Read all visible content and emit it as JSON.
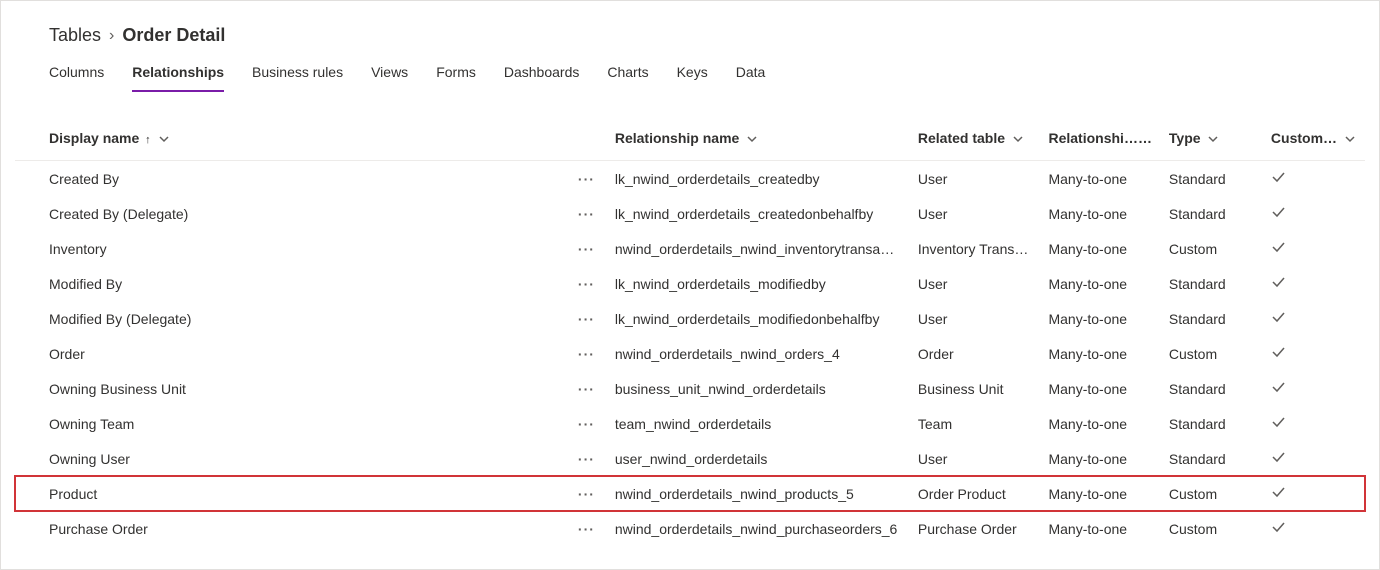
{
  "breadcrumb": {
    "root": "Tables",
    "current": "Order Detail"
  },
  "tabs": [
    {
      "label": "Columns",
      "active": false
    },
    {
      "label": "Relationships",
      "active": true
    },
    {
      "label": "Business rules",
      "active": false
    },
    {
      "label": "Views",
      "active": false
    },
    {
      "label": "Forms",
      "active": false
    },
    {
      "label": "Dashboards",
      "active": false
    },
    {
      "label": "Charts",
      "active": false
    },
    {
      "label": "Keys",
      "active": false
    },
    {
      "label": "Data",
      "active": false
    }
  ],
  "columns": {
    "display": "Display name",
    "relname": "Relationship name",
    "related": "Related table",
    "reltype": "Relationshi…",
    "type": "Type",
    "custom": "Custom…"
  },
  "rows": [
    {
      "display": "Created By",
      "relname": "lk_nwind_orderdetails_createdby",
      "related": "User",
      "reltype": "Many-to-one",
      "type": "Standard",
      "custom": true,
      "highlight": false
    },
    {
      "display": "Created By (Delegate)",
      "relname": "lk_nwind_orderdetails_createdonbehalfby",
      "related": "User",
      "reltype": "Many-to-one",
      "type": "Standard",
      "custom": true,
      "highlight": false
    },
    {
      "display": "Inventory",
      "relname": "nwind_orderdetails_nwind_inventorytransa…",
      "related": "Inventory Trans…",
      "reltype": "Many-to-one",
      "type": "Custom",
      "custom": true,
      "highlight": false
    },
    {
      "display": "Modified By",
      "relname": "lk_nwind_orderdetails_modifiedby",
      "related": "User",
      "reltype": "Many-to-one",
      "type": "Standard",
      "custom": true,
      "highlight": false
    },
    {
      "display": "Modified By (Delegate)",
      "relname": "lk_nwind_orderdetails_modifiedonbehalfby",
      "related": "User",
      "reltype": "Many-to-one",
      "type": "Standard",
      "custom": true,
      "highlight": false
    },
    {
      "display": "Order",
      "relname": "nwind_orderdetails_nwind_orders_4",
      "related": "Order",
      "reltype": "Many-to-one",
      "type": "Custom",
      "custom": true,
      "highlight": false
    },
    {
      "display": "Owning Business Unit",
      "relname": "business_unit_nwind_orderdetails",
      "related": "Business Unit",
      "reltype": "Many-to-one",
      "type": "Standard",
      "custom": true,
      "highlight": false
    },
    {
      "display": "Owning Team",
      "relname": "team_nwind_orderdetails",
      "related": "Team",
      "reltype": "Many-to-one",
      "type": "Standard",
      "custom": true,
      "highlight": false
    },
    {
      "display": "Owning User",
      "relname": "user_nwind_orderdetails",
      "related": "User",
      "reltype": "Many-to-one",
      "type": "Standard",
      "custom": true,
      "highlight": false
    },
    {
      "display": "Product",
      "relname": "nwind_orderdetails_nwind_products_5",
      "related": "Order Product",
      "reltype": "Many-to-one",
      "type": "Custom",
      "custom": true,
      "highlight": true
    },
    {
      "display": "Purchase Order",
      "relname": "nwind_orderdetails_nwind_purchaseorders_6",
      "related": "Purchase Order",
      "reltype": "Many-to-one",
      "type": "Custom",
      "custom": true,
      "highlight": false
    }
  ]
}
